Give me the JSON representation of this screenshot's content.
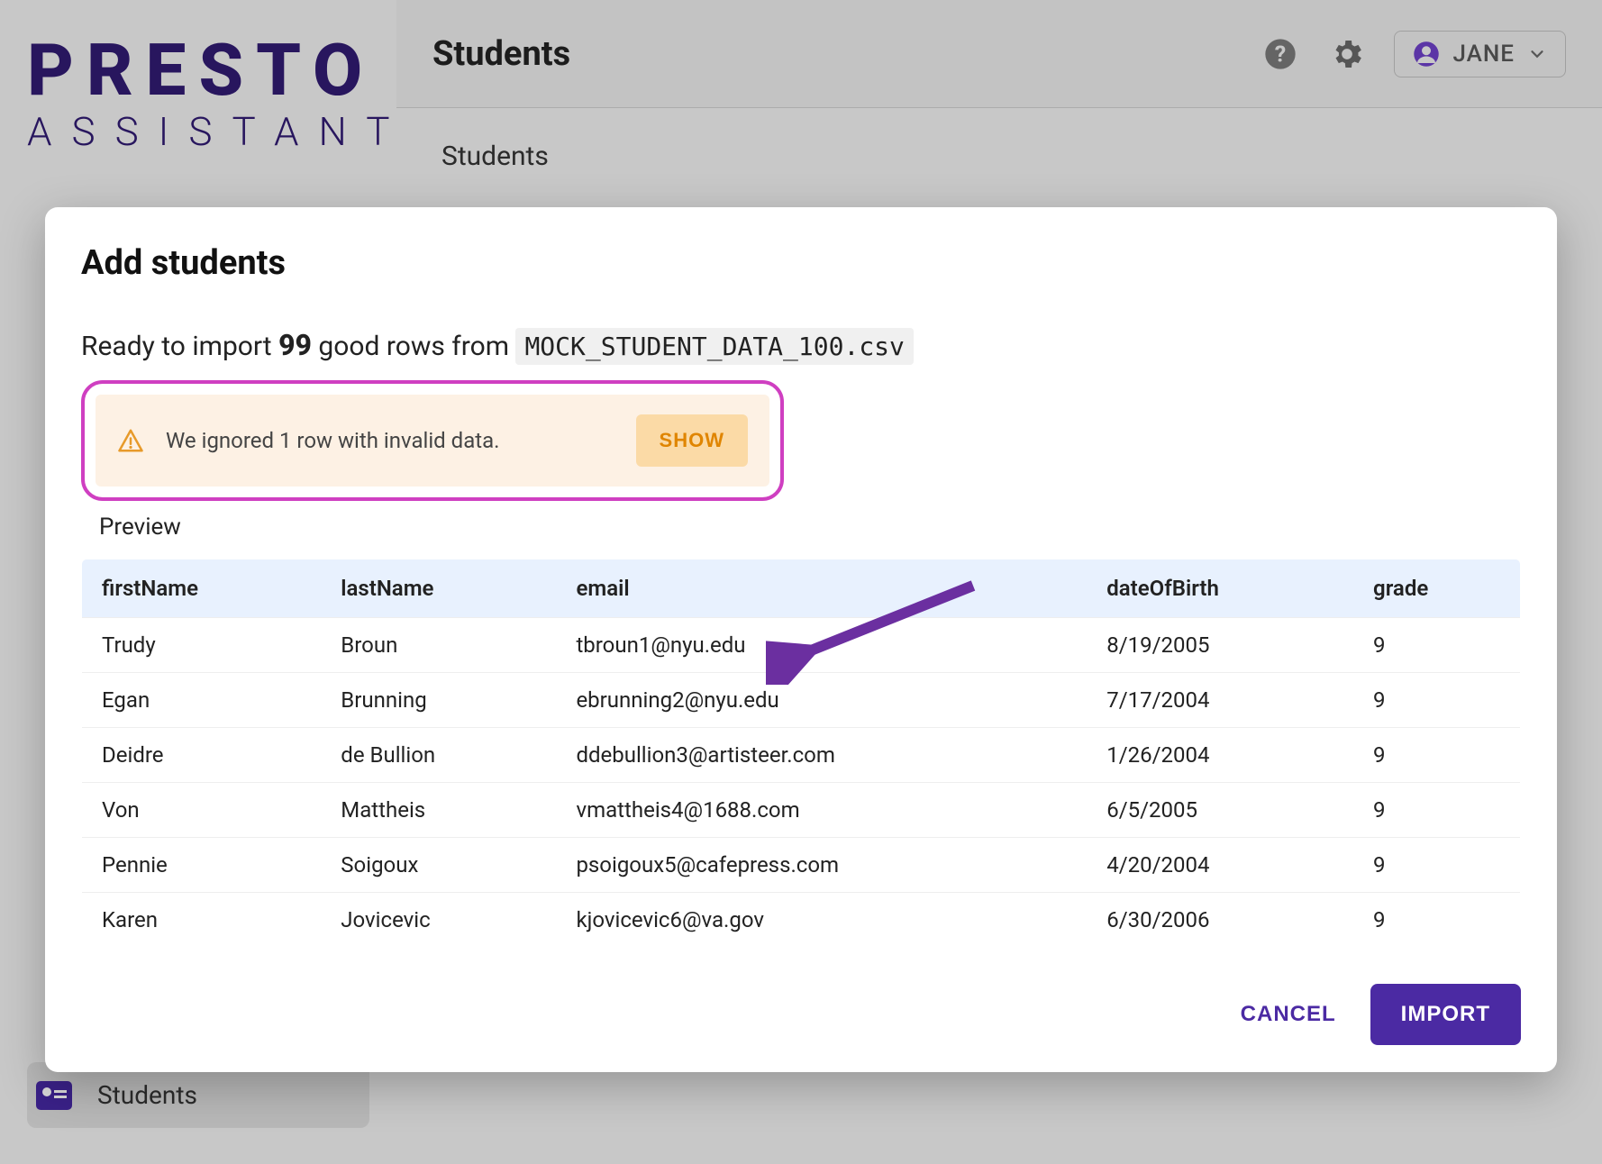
{
  "brand": {
    "line1": "PRESTO",
    "line2": "ASSISTANT"
  },
  "topbar": {
    "title": "Students",
    "user_name": "JANE"
  },
  "subheader": {
    "title": "Students"
  },
  "sidebar": {
    "students_label": "Students"
  },
  "dialog": {
    "title": "Add students",
    "import_prefix": "Ready to import ",
    "import_count": "99",
    "import_mid": " good rows from ",
    "import_filename": "MOCK_STUDENT_DATA_100.csv",
    "alert_text": "We ignored 1 row with invalid data.",
    "show_label": "SHOW",
    "preview_label": "Preview",
    "columns": [
      "firstName",
      "lastName",
      "email",
      "dateOfBirth",
      "grade"
    ],
    "rows": [
      {
        "firstName": "Trudy",
        "lastName": "Broun",
        "email": "tbroun1@nyu.edu",
        "dateOfBirth": "8/19/2005",
        "grade": "9"
      },
      {
        "firstName": "Egan",
        "lastName": "Brunning",
        "email": "ebrunning2@nyu.edu",
        "dateOfBirth": "7/17/2004",
        "grade": "9"
      },
      {
        "firstName": "Deidre",
        "lastName": "de Bullion",
        "email": "ddebullion3@artisteer.com",
        "dateOfBirth": "1/26/2004",
        "grade": "9"
      },
      {
        "firstName": "Von",
        "lastName": "Mattheis",
        "email": "vmattheis4@1688.com",
        "dateOfBirth": "6/5/2005",
        "grade": "9"
      },
      {
        "firstName": "Pennie",
        "lastName": "Soigoux",
        "email": "psoigoux5@cafepress.com",
        "dateOfBirth": "4/20/2004",
        "grade": "9"
      },
      {
        "firstName": "Karen",
        "lastName": "Jovicevic",
        "email": "kjovicevic6@va.gov",
        "dateOfBirth": "6/30/2006",
        "grade": "9"
      }
    ],
    "cancel_label": "CANCEL",
    "import_label": "IMPORT"
  }
}
